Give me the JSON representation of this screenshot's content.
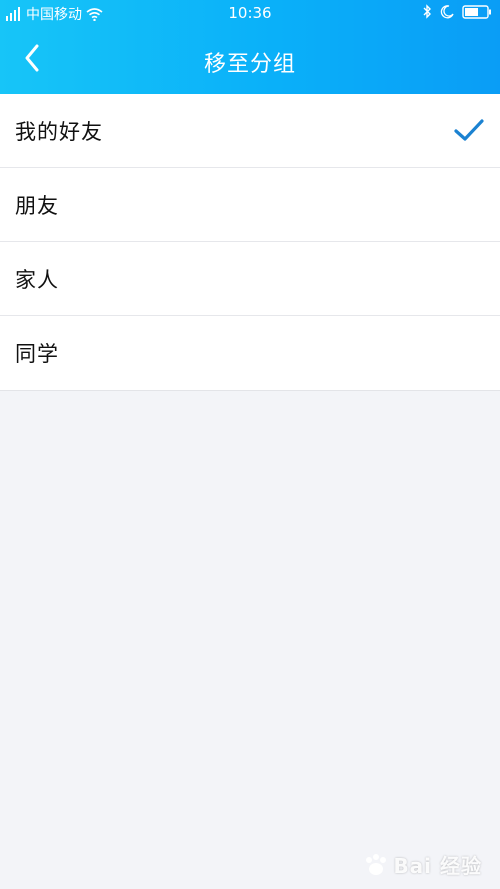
{
  "status_bar": {
    "carrier": "中国移动",
    "time": "10:36"
  },
  "nav": {
    "title": "移至分组"
  },
  "groups": [
    {
      "label": "我的好友",
      "selected": true
    },
    {
      "label": "朋友",
      "selected": false
    },
    {
      "label": "家人",
      "selected": false
    },
    {
      "label": "同学",
      "selected": false
    }
  ],
  "watermark": {
    "text": "Bai 经验"
  },
  "colors": {
    "accent": "#1b82d1",
    "header_start": "#17c5f8",
    "header_end": "#0a9df6"
  }
}
